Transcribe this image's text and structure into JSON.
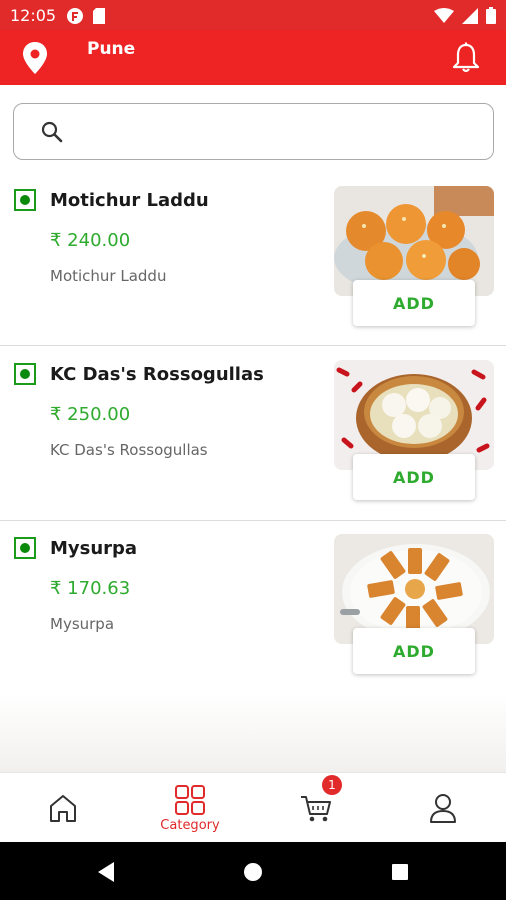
{
  "status_bar": {
    "time": "12:05"
  },
  "header": {
    "city": "Pune"
  },
  "search": {
    "placeholder": ""
  },
  "products": [
    {
      "name": "Motichur Laddu",
      "price": "₹ 240.00",
      "description": "Motichur Laddu",
      "add_label": "ADD"
    },
    {
      "name": "KC Das's Rossogullas",
      "price": "₹ 250.00",
      "description": "KC Das's Rossogullas",
      "add_label": "ADD"
    },
    {
      "name": "Mysurpa",
      "price": "₹ 170.63",
      "description": "Mysurpa",
      "add_label": "ADD"
    }
  ],
  "bottom_nav": {
    "items": [
      {
        "icon": "home-icon",
        "label": ""
      },
      {
        "icon": "category-icon",
        "label": "Category"
      },
      {
        "icon": "cart-icon",
        "label": "",
        "badge": "1"
      },
      {
        "icon": "profile-icon",
        "label": ""
      }
    ]
  },
  "colors": {
    "brand_red": "#ee2424",
    "price_green": "#2eab2e",
    "veg_green": "#0c8a0c"
  }
}
